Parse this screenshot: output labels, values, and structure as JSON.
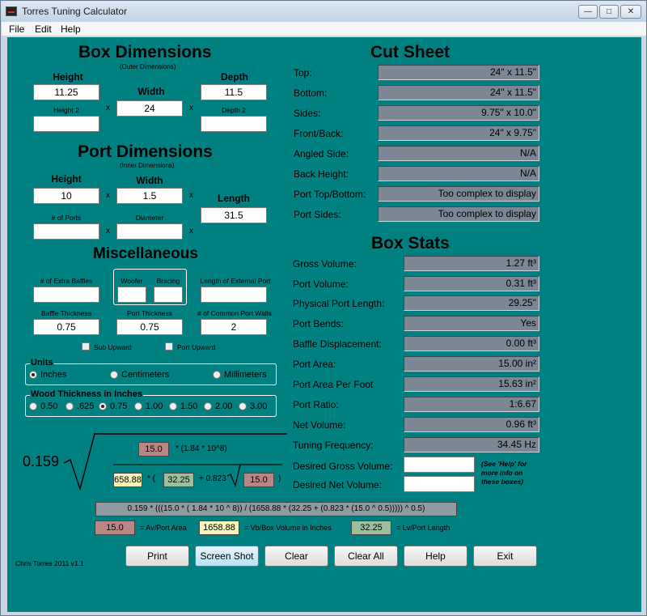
{
  "window": {
    "title": "Torres Tuning Calculator"
  },
  "menu": {
    "file": "File",
    "edit": "Edit",
    "help": "Help"
  },
  "box": {
    "title": "Box Dimensions",
    "subtitle": "(Outer Dimensions)",
    "height_label": "Height",
    "height": "11.25",
    "width_label": "Width",
    "width": "24",
    "depth_label": "Depth",
    "depth": "11.5",
    "height2_label": "Height 2",
    "height2": "",
    "depth2_label": "Depth 2",
    "depth2": ""
  },
  "port": {
    "title": "Port Dimensions",
    "subtitle": "(Inner Dimensions)",
    "height_label": "Height",
    "height": "10",
    "width_label": "Width",
    "width": "1.5",
    "length_label": "Length",
    "length": "31.5",
    "num_ports_label": "# of Ports",
    "num_ports": "",
    "diameter_label": "Diameter",
    "diameter": ""
  },
  "misc": {
    "title": "Miscellaneous",
    "extra_baffles_label": "# of Extra Baffles",
    "extra_baffles": "",
    "woofer_label": "Woofer",
    "woofer": "",
    "bracing_label": "Bracing",
    "bracing": "",
    "ext_port_label": "Length of External Port",
    "ext_port": "",
    "baffle_thickness_label": "Baffle Thickness",
    "baffle_thickness": "0.75",
    "port_thickness_label": "Port Thickness",
    "port_thickness": "0.75",
    "common_walls_label": "# of Common Port Walls",
    "common_walls": "2",
    "sub_upward": "Sub Upward",
    "port_upward": "Port Upward"
  },
  "multiply": "x",
  "units": {
    "title": "Units",
    "inches": "Inches",
    "centimeters": "Centimeters",
    "millimeters": "Millimeters"
  },
  "wood": {
    "title": "Wood Thickness in Inches",
    "options": [
      "0.50",
      ".625",
      "0.75",
      "1.00",
      "1.50",
      "2.00",
      "3.00"
    ]
  },
  "cut_sheet": {
    "title": "Cut Sheet",
    "rows": [
      {
        "label": "Top:",
        "value": "24\" x 11.5\""
      },
      {
        "label": "Bottom:",
        "value": "24\" x 11.5\""
      },
      {
        "label": "Sides:",
        "value": "9.75\" x 10.0\""
      },
      {
        "label": "Front/Back:",
        "value": "24\" x 9.75\""
      },
      {
        "label": "Angled Side:",
        "value": "N/A"
      },
      {
        "label": "Back Height:",
        "value": "N/A"
      },
      {
        "label": "Port Top/Bottom:",
        "value": "Too complex to display"
      },
      {
        "label": "Port Sides:",
        "value": "Too complex to display"
      }
    ]
  },
  "box_stats": {
    "title": "Box Stats",
    "rows": [
      {
        "label": "Gross Volume:",
        "value": "1.27 ft³"
      },
      {
        "label": "Port Volume:",
        "value": "0.31 ft³"
      },
      {
        "label": "Physical Port Length:",
        "value": "29.25\""
      },
      {
        "label": "Port Bends:",
        "value": "Yes"
      },
      {
        "label": "Baffle Displacement:",
        "value": "0.00 ft³"
      },
      {
        "label": "Port Area:",
        "value": "15.00 in²"
      },
      {
        "label": "Port Area Per Foot",
        "value": "15.63 in²"
      },
      {
        "label": "Port Ratio:",
        "value": "1:6.67"
      },
      {
        "label": "Net Volume:",
        "value": "0.96 ft³"
      },
      {
        "label": "Tuning Frequency:",
        "value": "34.45 Hz"
      }
    ],
    "desired_gross_label": "Desired Gross Volume:",
    "desired_gross": "",
    "desired_net_label": "Desired Net Volume:",
    "desired_net": "",
    "help_note": "(See 'Help' for more info on these boxes)"
  },
  "formula": {
    "coef": "0.159",
    "num_av": "15.0",
    "num_mult": "* (1.84 * 10^8)",
    "vb": "658.88",
    "paren_open": "* (",
    "lv": "32.25",
    "plus_coef": "+ 0.823",
    "av_inner": "15.0",
    "paren_close": ")",
    "full": "0.159 * (((15.0 * ( 1.84 * 10 ^ 8)) / (1658.88 * (32.25 + (0.823 * (15.0 ^ 0.5))))) ^ 0.5)",
    "legend_av": "15.0",
    "legend_av_text": "= Av/Port Area",
    "legend_vb": "1658.88",
    "legend_vb_text": "= Vb/Box Volume in Inches",
    "legend_lv": "32.25",
    "legend_lv_text": "= Lv/Port Length"
  },
  "buttons": {
    "print": "Print",
    "screenshot": "Screen Shot",
    "clear": "Clear",
    "clear_all": "Clear All",
    "help": "Help",
    "exit": "Exit"
  },
  "footer": "Chris Torres 2011 v1.1"
}
